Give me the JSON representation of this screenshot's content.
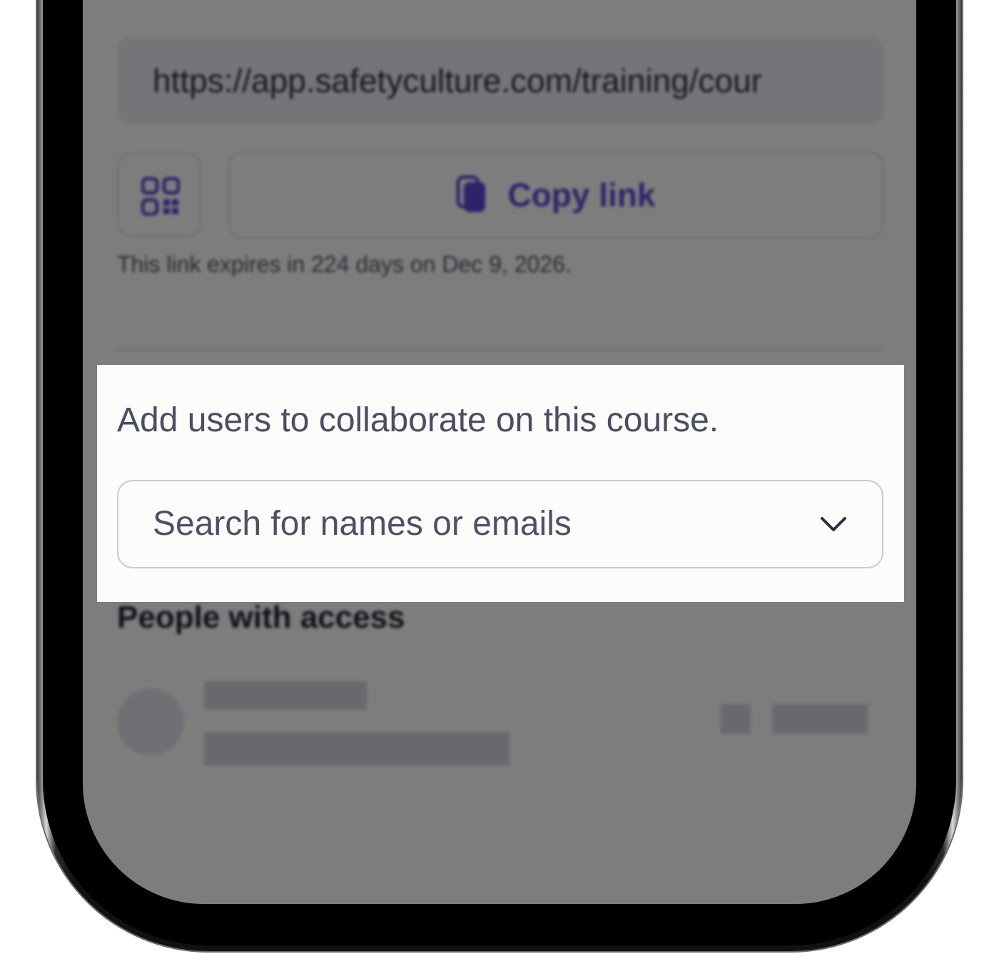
{
  "share": {
    "url": "https://app.safetyculture.com/training/cour",
    "copy_label": "Copy link",
    "expiry_text": "This link expires in 224 days on Dec 9, 2026."
  },
  "collaborators": {
    "instruction": "Add users to collaborate on this course.",
    "search_placeholder": "Search for names or emails"
  },
  "access": {
    "title": "People with access"
  },
  "colors": {
    "accent": "#5b47d6",
    "overlay": "rgba(0,0,0,0.5)"
  },
  "icons": [
    "qr-code-icon",
    "copy-icon",
    "chevron-down-icon"
  ]
}
